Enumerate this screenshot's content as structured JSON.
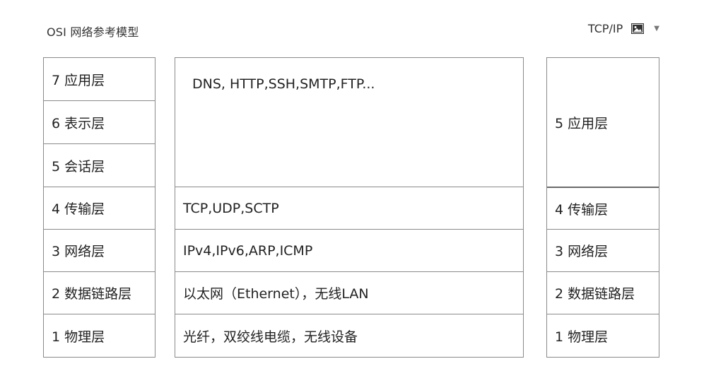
{
  "header": {
    "title": "OSI 网络参考模型",
    "right_label": "TCP/IP",
    "image_icon": "image-icon",
    "dropdown_icon": "chevron-down-icon"
  },
  "osi_layers": [
    "7 应用层",
    "6 表示层",
    "5 会话层",
    "4 传输层",
    "3 网络层",
    "2 数据链路层",
    "1 物理层"
  ],
  "protocols": {
    "application": "DNS, HTTP,SSH,SMTP,FTP...",
    "transport": "TCP,UDP,SCTP",
    "network": "IPv4,IPv6,ARP,ICMP",
    "datalink": "以太网（Ethernet），无线LAN",
    "physical": "光纤，双绞线电缆，无线设备"
  },
  "tcpip_layers": [
    "5 应用层",
    "4 传输层",
    "3 网络层",
    "2 数据链路层",
    "1 物理层"
  ],
  "colors": {
    "border": "#8a8a8a",
    "text": "#222222"
  }
}
